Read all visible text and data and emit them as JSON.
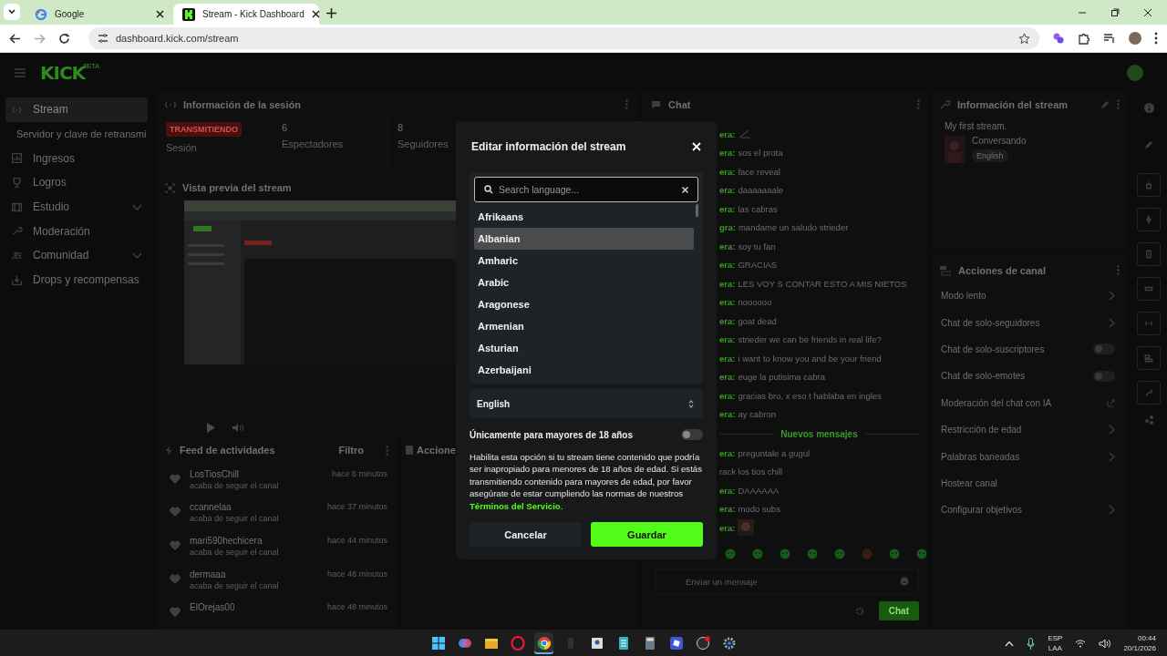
{
  "browser": {
    "tabs": [
      {
        "title": "Google",
        "selected": false
      },
      {
        "title": "Stream - Kick Dashboard",
        "selected": true
      }
    ],
    "address": "dashboard.kick.com/stream"
  },
  "header": {
    "logo": "KICK",
    "logo_badge": "BETA"
  },
  "sidebar": {
    "items": [
      {
        "label": "Stream",
        "kind": "item",
        "selected": true
      },
      {
        "label": "Servidor y clave de retransmi",
        "kind": "sub",
        "selected": false
      },
      {
        "label": "Ingresos",
        "kind": "item",
        "selected": false
      },
      {
        "label": "Logros",
        "kind": "item",
        "selected": false
      },
      {
        "label": "Estudio",
        "kind": "group",
        "selected": false,
        "expanded": false
      },
      {
        "label": "Moderación",
        "kind": "item",
        "selected": false
      },
      {
        "label": "Comunidad",
        "kind": "group",
        "selected": false,
        "expanded": false
      },
      {
        "label": "Drops y recompensas",
        "kind": "item",
        "selected": false
      }
    ]
  },
  "session": {
    "title": "Información de la sesión",
    "status": "TRANSMITIENDO",
    "status_label": "Sesión",
    "stats": [
      {
        "value": "6",
        "label": "Espectadores"
      },
      {
        "value": "8",
        "label": "Seguidores"
      }
    ]
  },
  "preview": {
    "title": "Vista previa del stream",
    "kind": "picture"
  },
  "feed": {
    "title": "Feed de actividades",
    "filter": "Filtro",
    "items": [
      {
        "user": "LosTiosChill",
        "time": "hace 6 minutos",
        "action": "acaba de seguir el canal"
      },
      {
        "user": "ccannelaa",
        "time": "hace 37 minutos",
        "action": "acaba de seguir el canal"
      },
      {
        "user": "mari590hechicera",
        "time": "hace 44 minutos",
        "action": "acaba de seguir el canal"
      },
      {
        "user": "dermaaa",
        "time": "hace 48 minutos",
        "action": "acaba de seguir el canal"
      },
      {
        "user": "ElOrejas00",
        "time": "hace 48 minutos"
      }
    ]
  },
  "actions_panel": {
    "title": "Accione"
  },
  "chat": {
    "title": "Chat",
    "messages": [
      {
        "user": "era:",
        "kind": "emote"
      },
      {
        "user": "era:",
        "text": "sos el prota",
        "kind": "text"
      },
      {
        "user": "era:",
        "text": "face reveal",
        "kind": "text"
      },
      {
        "user": "era:",
        "text": "daaaaaaale",
        "kind": "text"
      },
      {
        "user": "era:",
        "text": "las cabras",
        "kind": "text"
      },
      {
        "user": "gra:",
        "text": "mandame un saludo strieder",
        "kind": "text"
      },
      {
        "user": "era:",
        "text": "soy tu fan",
        "kind": "text"
      },
      {
        "user": "era:",
        "text": "GRACIAS",
        "kind": "text"
      },
      {
        "user": "era:",
        "text": "LES VOY S CONTAR ESTO A MIS NIETOS",
        "kind": "text"
      },
      {
        "user": "era:",
        "text": "noooooo",
        "kind": "text"
      },
      {
        "user": "era:",
        "text": "goat dead",
        "kind": "text"
      },
      {
        "user": "era:",
        "text": "strieder we can be friends in real life?",
        "kind": "text"
      },
      {
        "user": "era:",
        "text": "i want to know you and be your friend",
        "kind": "text"
      },
      {
        "user": "era:",
        "text": "euge la putisima cabra",
        "kind": "text"
      },
      {
        "user": "era:",
        "text": "gracias bro, x eso t hablaba en ingles",
        "kind": "text"
      },
      {
        "user": "era:",
        "text": "ay cabron",
        "kind": "text"
      }
    ],
    "new_divider": "Nuevos mensajes",
    "new_messages": [
      {
        "user": "era:",
        "text": "preguntale a gugul",
        "kind": "text"
      },
      {
        "text": "rack los tios chill",
        "kind": "text"
      },
      {
        "user": "era:",
        "text": "DAAAAAA",
        "kind": "text"
      },
      {
        "user": "era:",
        "text": "modo subs",
        "kind": "text"
      },
      {
        "user": "era:",
        "kind": "picture"
      }
    ],
    "input_placeholder": "Enviar un mensaje",
    "send": "Chat"
  },
  "stream_info": {
    "title": "Información del stream",
    "stream_title": "My first stream.",
    "category": "Conversando",
    "tags": [
      "English"
    ]
  },
  "channel_actions": {
    "title": "Acciones de canal",
    "items": [
      {
        "label": "Modo lento",
        "kind": "link"
      },
      {
        "label": "Chat de solo-seguidores",
        "kind": "link"
      },
      {
        "label": "Chat de solo-suscriptores",
        "kind": "toggle",
        "on": false
      },
      {
        "label": "Chat de solo-emotes",
        "kind": "toggle",
        "on": false
      },
      {
        "label": "Moderación del chat con IA",
        "kind": "external"
      },
      {
        "label": "Restricción de edad",
        "kind": "link"
      },
      {
        "label": "Palabras baneadas",
        "kind": "link"
      },
      {
        "label": "Hostear canal",
        "kind": "plain"
      },
      {
        "label": "Configurar objetivos",
        "kind": "link"
      }
    ]
  },
  "modal": {
    "title": "Editar información del stream",
    "search_placeholder": "Search language...",
    "languages": [
      {
        "name": "Afrikaans",
        "selected": false
      },
      {
        "name": "Albanian",
        "selected": true
      },
      {
        "name": "Amharic",
        "selected": false
      },
      {
        "name": "Arabic",
        "selected": false
      },
      {
        "name": "Aragonese",
        "selected": false
      },
      {
        "name": "Armenian",
        "selected": false
      },
      {
        "name": "Asturian",
        "selected": false
      },
      {
        "name": "Azerbaijani",
        "selected": false
      }
    ],
    "language_value": "English",
    "mature": {
      "label": "Únicamente para mayores de 18 años",
      "on": false
    },
    "notice": "Habilita esta opción si tu stream tiene contenido que podría ser inapropiado para menores de 18 años de edad. Si estás transmitiendo contenido para mayores de edad, por favor asegúrate de estar cumpliendo las normas de nuestros",
    "terms_link": "Términos del Servicio",
    "terms_end": ".",
    "cancel": "Cancelar",
    "save": "Guardar"
  },
  "taskbar": {
    "language": "ESP",
    "layout": "LAA",
    "time": "00:44",
    "date": "20/1/2026"
  }
}
